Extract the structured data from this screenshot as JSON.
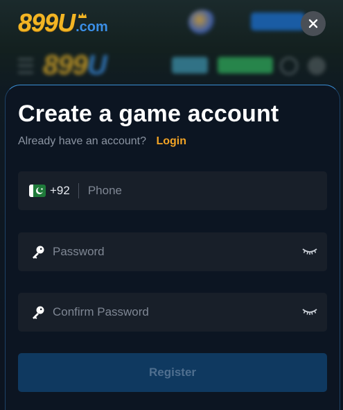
{
  "header": {
    "logo_main": "899U",
    "logo_domain": ".com",
    "close_icon": "close-icon"
  },
  "modal": {
    "title": "Create a game account",
    "subtitle": "Already have an account?",
    "login_link": "Login",
    "phone": {
      "country_flag": "pakistan-flag-icon",
      "country_code": "+92",
      "placeholder": "Phone",
      "value": ""
    },
    "password": {
      "icon": "key-icon",
      "placeholder": "Password",
      "value": "",
      "toggle_icon": "eye-closed-icon"
    },
    "confirm_password": {
      "icon": "key-icon",
      "placeholder": "Confirm Password",
      "value": "",
      "toggle_icon": "eye-closed-icon"
    },
    "register_label": "Register"
  },
  "colors": {
    "accent": "#f3a425",
    "brand_blue": "#3b8fe6",
    "register_disabled_bg": "#0f3960"
  }
}
